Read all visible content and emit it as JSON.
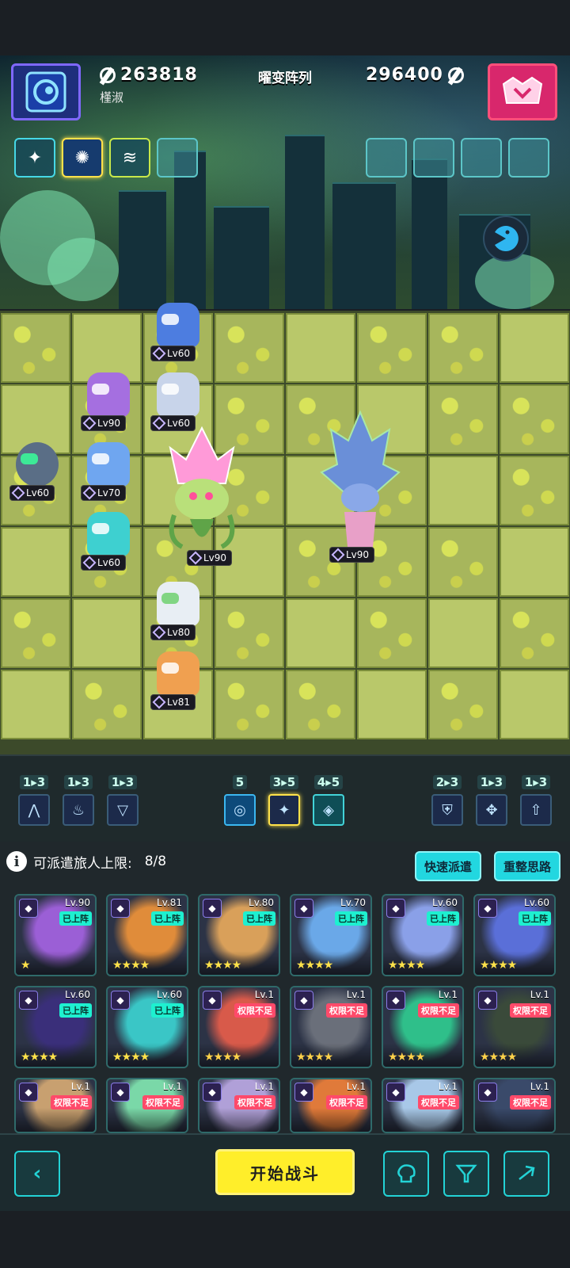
{
  "header": {
    "player_power": "263818",
    "player_name": "槿淑",
    "mode_title": "曜变阵列",
    "enemy_power": "296400"
  },
  "skill_slots_left": [
    "sparkle-staff",
    "vortex-orb",
    "wave-scroll",
    "empty"
  ],
  "skill_slots_right": [
    "empty",
    "empty",
    "empty",
    "empty"
  ],
  "board_units": [
    {
      "level": "Lv60",
      "name": "hat-girl"
    },
    {
      "level": "Lv90",
      "name": "cat-girl-purple"
    },
    {
      "level": "Lv60",
      "name": "mechanic-girl"
    },
    {
      "level": "Lv60",
      "name": "robot-helmet"
    },
    {
      "level": "Lv70",
      "name": "blue-hair-girl"
    },
    {
      "level": "Lv60",
      "name": "teal-hair-girl"
    },
    {
      "level": "Lv90",
      "name": "lotus-plant"
    },
    {
      "level": "Lv90",
      "name": "crystal-flower-enemy"
    },
    {
      "level": "Lv80",
      "name": "glasses-boy"
    },
    {
      "level": "Lv81",
      "name": "fox-girl"
    }
  ],
  "synergies": {
    "left": [
      {
        "count": "1▸3",
        "icon": "mountain"
      },
      {
        "count": "1▸3",
        "icon": "flame"
      },
      {
        "count": "1▸3",
        "icon": "triangle-wing"
      }
    ],
    "center": [
      {
        "count": "5",
        "icon": "swirl"
      },
      {
        "count": "3▸5",
        "icon": "star"
      },
      {
        "count": "4▸5",
        "icon": "diamond"
      }
    ],
    "right": [
      {
        "count": "2▸3",
        "icon": "shield"
      },
      {
        "count": "1▸3",
        "icon": "bow"
      },
      {
        "count": "1▸3",
        "icon": "arrow-up"
      }
    ]
  },
  "roster": {
    "limit_label": "可派遣旅人上限:",
    "limit_value": "8/8",
    "quick_dispatch": "快速派遣",
    "reorganize": "重整思路",
    "status_on": "已上阵",
    "status_locked": "权限不足",
    "cards": [
      {
        "level": "Lv.90",
        "status": "已上阵",
        "stars": "★",
        "color": "#9b5fd6"
      },
      {
        "level": "Lv.81",
        "status": "已上阵",
        "stars": "★★★★",
        "color": "#e08c3a"
      },
      {
        "level": "Lv.80",
        "status": "已上阵",
        "stars": "★★★★",
        "color": "#d9a05a"
      },
      {
        "level": "Lv.70",
        "status": "已上阵",
        "stars": "★★★★",
        "color": "#6aa8e8"
      },
      {
        "level": "Lv.60",
        "status": "已上阵",
        "stars": "★★★★",
        "color": "#8aa0e8"
      },
      {
        "level": "Lv.60",
        "status": "已上阵",
        "stars": "★★★★",
        "color": "#5a6fd8"
      },
      {
        "level": "Lv.60",
        "status": "已上阵",
        "stars": "★★★★",
        "color": "#3a2f7a"
      },
      {
        "level": "Lv.60",
        "status": "已上阵",
        "stars": "★★★★",
        "color": "#3ac6c6"
      },
      {
        "level": "Lv.1",
        "status": "权限不足",
        "stars": "★★★★",
        "color": "#d85a4a"
      },
      {
        "level": "Lv.1",
        "status": "权限不足",
        "stars": "★★★★",
        "color": "#6a6f7a"
      },
      {
        "level": "Lv.1",
        "status": "权限不足",
        "stars": "★★★★",
        "color": "#2fbf8a"
      },
      {
        "level": "Lv.1",
        "status": "权限不足",
        "stars": "★★★★",
        "color": "#3a4a3a"
      },
      {
        "level": "Lv.1",
        "status": "权限不足",
        "stars": "",
        "color": "#c8a070"
      },
      {
        "level": "Lv.1",
        "status": "权限不足",
        "stars": "",
        "color": "#7ad8a8"
      },
      {
        "level": "Lv.1",
        "status": "权限不足",
        "stars": "",
        "color": "#b0a0d8"
      },
      {
        "level": "Lv.1",
        "status": "权限不足",
        "stars": "",
        "color": "#e07a3a"
      },
      {
        "level": "Lv.1",
        "status": "权限不足",
        "stars": "",
        "color": "#a8c8e8"
      },
      {
        "level": "Lv.1",
        "status": "权限不足",
        "stars": "",
        "color": "#3a4a6a"
      }
    ]
  },
  "bottom": {
    "start_battle": "开始战斗",
    "back_icon": "chevron-left",
    "brain_icon": "brain",
    "filter_icon": "filter",
    "sort_icon": "sort"
  },
  "colors": {
    "accent_cyan": "#22d7e0",
    "start_yellow": "#ffee2a",
    "locked_red": "#ff4a6a",
    "on_teal": "#1ef0d0"
  }
}
